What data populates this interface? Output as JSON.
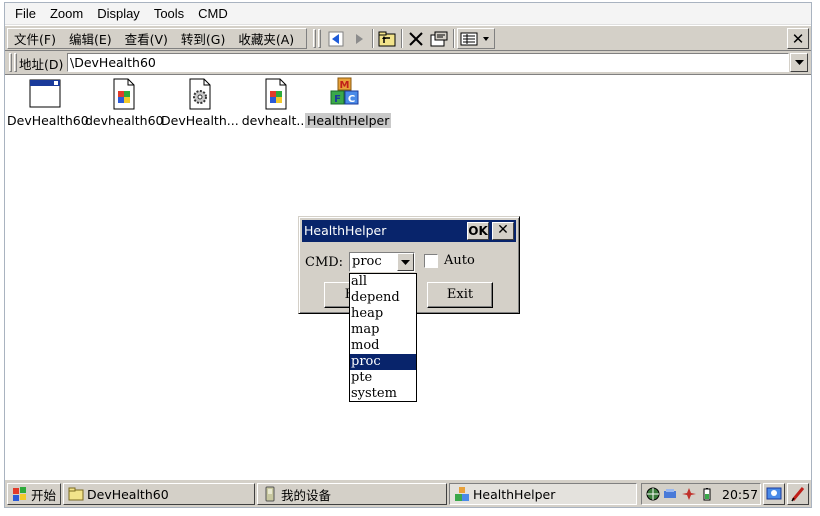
{
  "host_menu": [
    "File",
    "Zoom",
    "Display",
    "Tools",
    "CMD"
  ],
  "ce_menu": [
    "文件(F)",
    "编辑(E)",
    "查看(V)",
    "转到(G)",
    "收藏夹(A)"
  ],
  "toolbar": {
    "icons": [
      "back-arrow-icon",
      "forward-arrow-icon",
      "up-folder-icon",
      "delete-icon",
      "properties-icon",
      "view-mode-icon"
    ],
    "close_label": "✕"
  },
  "address": {
    "label": "地址(D)",
    "value": "\\DevHealth60"
  },
  "files": [
    {
      "label": "DevHealth60",
      "icon": "window-app-icon"
    },
    {
      "label": "devhealth60",
      "icon": "document-icon"
    },
    {
      "label": "DevHealth...",
      "icon": "settings-file-icon"
    },
    {
      "label": "devhealt...",
      "icon": "document-icon"
    },
    {
      "label": "HealthHelper",
      "icon": "mfc-app-icon"
    }
  ],
  "dialog": {
    "title": "HealthHelper",
    "ok_label": "OK",
    "close_label": "✕",
    "cmd_label": "CMD:",
    "cmd_value": "proc",
    "auto_label": "Auto",
    "auto_checked": false,
    "exec_label": "Exe",
    "exit_label": "Exit",
    "options": [
      "all",
      "depend",
      "heap",
      "map",
      "mod",
      "proc",
      "pte",
      "system"
    ],
    "selected_option": "proc"
  },
  "taskbar": {
    "start_label": "开始",
    "tasks": [
      "DevHealth60",
      "我的设备",
      "HealthHelper"
    ],
    "active_task": "HealthHelper",
    "clock": "20:57"
  },
  "colors": {
    "title_bar": "#08246b",
    "chrome": "#d4d0c8",
    "selection": "#08246b"
  }
}
